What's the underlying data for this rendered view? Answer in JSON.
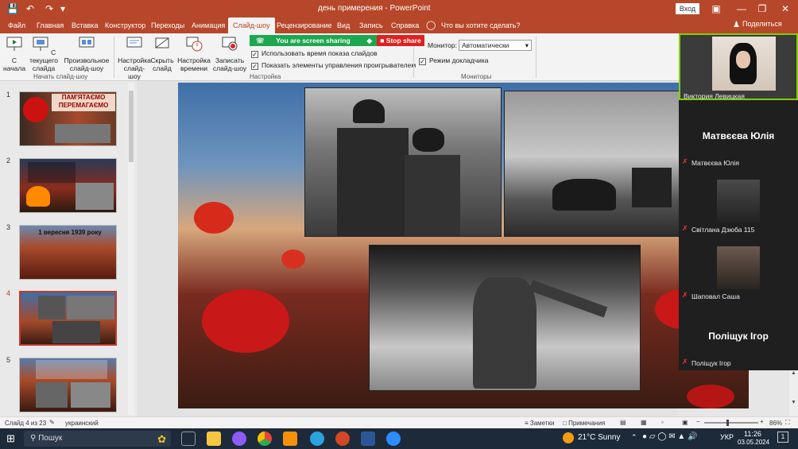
{
  "titlebar": {
    "title": "день примерения  -  PowerPoint",
    "signin": "Вход",
    "colors": {
      "accent": "#b7472a"
    }
  },
  "tabs": [
    "Файл",
    "Главная",
    "Вставка",
    "Конструктор",
    "Переходы",
    "Анимация",
    "Слайд-шоу",
    "Рецензирование",
    "Вид",
    "Запись",
    "Справка"
  ],
  "active_tab": "Слайд-шоу",
  "tell_me": "Что вы хотите сделать?",
  "share": "Поделиться",
  "ribbon": {
    "btn_from_start": "С начала",
    "btn_from_current": "С текущего слайда",
    "btn_custom": "Произвольное слайд-шоу",
    "group_start": "Начать слайд-шоу",
    "btn_setup": "Настройка слайд-шоу",
    "btn_hide": "Скрыть слайд",
    "btn_rehearse": "Настройка времени",
    "btn_record": "Записать слайд-шоу",
    "chk_timings": "Использовать время показа слайдов",
    "chk_controls": "Показать элементы управления проигрывателем",
    "group_setup": "Настройка",
    "monitor_label": "Монитор:",
    "monitor_value": "Автоматически",
    "chk_presenter": "Режим докладчика",
    "group_monitors": "Мониторы"
  },
  "screen_share": {
    "banner": "You are screen sharing",
    "stop": "Stop share"
  },
  "slides": [
    {
      "num": "1",
      "title": "ПАМ'ЯТАЄМО ПЕРЕМАГАЄМО"
    },
    {
      "num": "2",
      "title": ""
    },
    {
      "num": "3",
      "title": "1 вересня 1939 року"
    },
    {
      "num": "4",
      "title": ""
    },
    {
      "num": "5",
      "title": ""
    }
  ],
  "participants": [
    {
      "name": "Виктория Левицкая",
      "big": ""
    },
    {
      "name": "Матвєєва Юлія",
      "big": "Матвєєва Юлія"
    },
    {
      "name": "Світлана Дзюба 115",
      "big": ""
    },
    {
      "name": "Шаповал Саша",
      "big": ""
    },
    {
      "name": "Поліщук Ігор",
      "big": "Поліщук Ігор"
    }
  ],
  "status": {
    "slide": "Слайд 4 из 23",
    "language": "украинский",
    "notes": "Заметки",
    "comments": "Примечания",
    "zoom": "86%"
  },
  "taskbar": {
    "search": "Пошук",
    "weather": "21°C  Sunny",
    "lang": "УКР",
    "time": "11:26",
    "date": "03.05.2024",
    "notif": "1"
  }
}
